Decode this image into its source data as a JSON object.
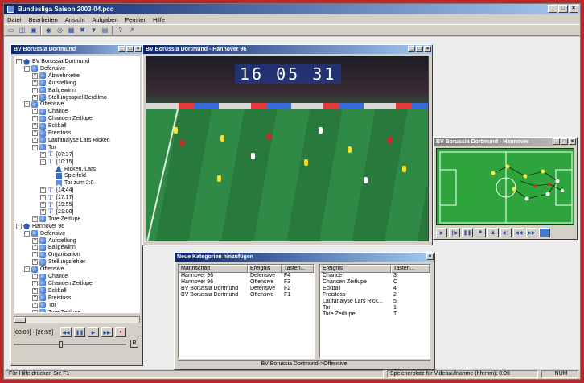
{
  "app": {
    "title": "Bundesliga Saison 2003-04.pco",
    "window_controls": [
      "_",
      "×"
    ]
  },
  "menu": [
    "Datei",
    "Bearbeiten",
    "Ansicht",
    "Aufgaben",
    "Fenster",
    "Hilfe"
  ],
  "tree_window": {
    "title": "BV Borussia Dortmund",
    "items": [
      {
        "label": "BV Borussia Dortmund",
        "icon": "club-icon"
      },
      {
        "label": "Defensive",
        "icon": "folder-icon"
      },
      {
        "label": "Abwehrkette",
        "icon": "folder-icon"
      },
      {
        "label": "Aufstellung",
        "icon": "folder-icon"
      },
      {
        "label": "Ballgewinn",
        "icon": "folder-icon"
      },
      {
        "label": "Stellungsspiel Berdilmo",
        "icon": "folder-icon"
      },
      {
        "label": "Offensive",
        "icon": "folder-icon"
      },
      {
        "label": "Chance",
        "icon": "folder-icon"
      },
      {
        "label": "Chancen Zeitlupe",
        "icon": "folder-icon"
      },
      {
        "label": "Eckball",
        "icon": "folder-icon"
      },
      {
        "label": "Freistoss",
        "icon": "folder-icon"
      },
      {
        "label": "Laufanalyse Lars Ricken",
        "icon": "folder-icon"
      },
      {
        "label": "Tor",
        "icon": "folder-icon"
      },
      {
        "label": "[07:37]",
        "icon": "time-icon"
      },
      {
        "label": "[10:15]",
        "icon": "time-icon"
      },
      {
        "label": "Ricken, Lars",
        "icon": "person-icon"
      },
      {
        "label": "Spielfeld",
        "icon": "field-icon"
      },
      {
        "label": "Tor zum 2:0",
        "icon": "goal-icon"
      },
      {
        "label": "[14:44]",
        "icon": "time-icon"
      },
      {
        "label": "[17:17]",
        "icon": "time-icon"
      },
      {
        "label": "[19:55]",
        "icon": "time-icon"
      },
      {
        "label": "[21:00]",
        "icon": "time-icon"
      },
      {
        "label": "Tore Zeitlupe",
        "icon": "folder-icon"
      },
      {
        "label": "Hannover 96",
        "icon": "club-icon"
      },
      {
        "label": "Defensive",
        "icon": "folder-icon"
      },
      {
        "label": "Aufstellung",
        "icon": "folder-icon"
      },
      {
        "label": "Ballgewinn",
        "icon": "folder-icon"
      },
      {
        "label": "Organisation",
        "icon": "folder-icon"
      },
      {
        "label": "Stellungsfehler",
        "icon": "folder-icon"
      },
      {
        "label": "Offensive",
        "icon": "folder-icon"
      },
      {
        "label": "Chance",
        "icon": "folder-icon"
      },
      {
        "label": "Chancen Zeitlupe",
        "icon": "folder-icon"
      },
      {
        "label": "Eckball",
        "icon": "folder-icon"
      },
      {
        "label": "Freistoss",
        "icon": "folder-icon"
      },
      {
        "label": "Tor",
        "icon": "folder-icon"
      },
      {
        "label": "Tore Zeitlupe",
        "icon": "folder-icon"
      }
    ],
    "time_range": "[00:00] - [26:55]",
    "r_button": "R"
  },
  "video_window": {
    "title": "BV Borussia Dortmund - Hannover 96",
    "clock": "16 05 31"
  },
  "pitch_window": {
    "title": "BV Borussia Dortmund - Hannover"
  },
  "dialog": {
    "title": "Neue Kategorien hinzufügen",
    "close": "×",
    "left_headers": [
      "Mannschaft",
      "Ereignis",
      "Tasten..."
    ],
    "left_rows": [
      [
        "Hannover 96",
        "Defensive",
        "F4"
      ],
      [
        "Hannover 96",
        "Offensive",
        "F3"
      ],
      [
        "BV Borussia Dortmund",
        "Defensive",
        "F2"
      ],
      [
        "BV Borussia Dortmund",
        "Offensive",
        "F1"
      ]
    ],
    "right_headers": [
      "Ereignis",
      "Tasten..."
    ],
    "right_rows": [
      [
        "Chance",
        "3"
      ],
      [
        "Chancen Zeitlupe",
        "C"
      ],
      [
        "Eckball",
        "4"
      ],
      [
        "Freistoss",
        "2"
      ],
      [
        "Laufanalyse Lars Rick...",
        "5"
      ],
      [
        "Tor",
        "1"
      ],
      [
        "Tore Zeitlupe",
        "T"
      ]
    ],
    "footer": "BV Borussia Dortmund->Offensive"
  },
  "status": {
    "help": "Für Hilfe drücken Sie F1",
    "storage": "Speicherplatz für Videoaufnahme (hh:mm): 0:09",
    "num": "NUM"
  }
}
